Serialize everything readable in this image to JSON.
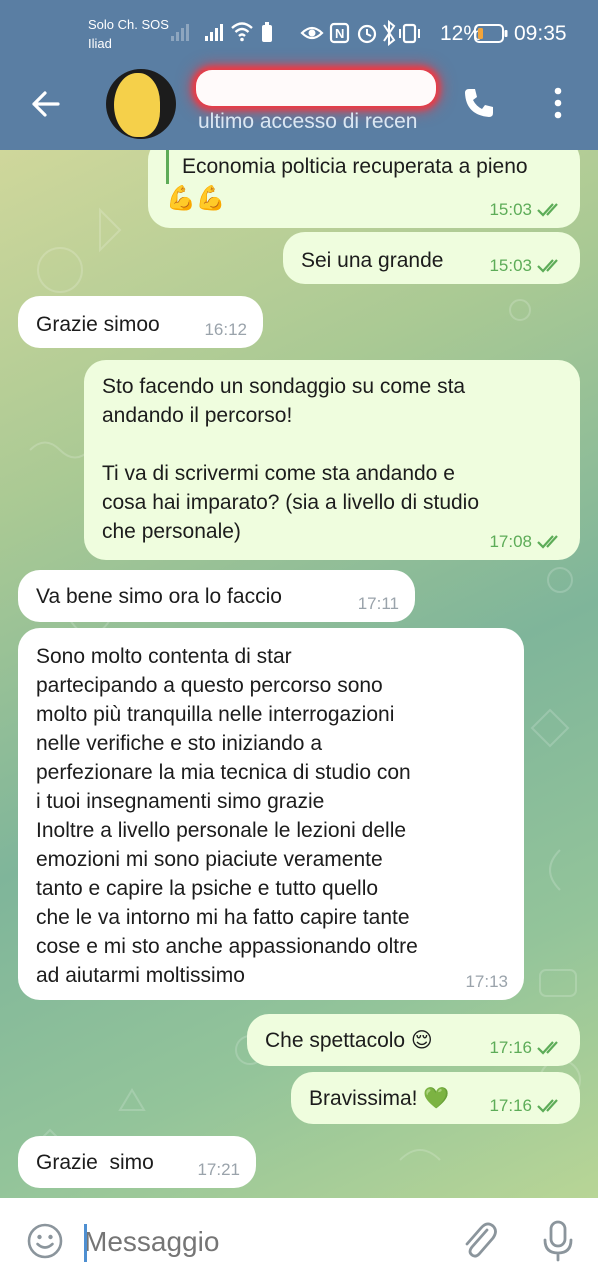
{
  "status_bar": {
    "carrier_1": "Solo Ch. SOS",
    "carrier_2": "Iliad",
    "battery_percent": "12%",
    "time": "09:35"
  },
  "header": {
    "contact_name": "",
    "last_seen": "ultimo accesso di recen"
  },
  "messages": [
    {
      "dir": "out",
      "reply_text": "Economia polticia  recuperata a pieno",
      "emoji": "💪💪",
      "time": "15:03",
      "read": true
    },
    {
      "dir": "out",
      "text": "Sei una grande",
      "time": "15:03",
      "read": true
    },
    {
      "dir": "in",
      "text": "Grazie simoo",
      "time": "16:12"
    },
    {
      "dir": "out",
      "text": "Sto facendo un sondaggio su come sta\nandando il percorso!\n\nTi va di scrivermi come sta andando e\ncosa hai imparato? (sia a livello di studio\nche personale)",
      "time": "17:08",
      "read": true
    },
    {
      "dir": "in",
      "text": "Va bene simo ora lo faccio",
      "time": "17:11"
    },
    {
      "dir": "in",
      "text": "Sono molto contenta di star\npartecipando a questo percorso sono\nmolto più tranquilla nelle interrogazioni\nnelle verifiche e sto iniziando a\nperfezionare la mia tecnica di studio con\ni tuoi insegnamenti simo grazie\nInoltre a livello personale le lezioni delle\nemozioni mi sono piaciute veramente\ntanto e capire la psiche e tutto quello\nche le va intorno mi ha fatto capire tante\ncose e mi sto anche appassionando oltre\nad aiutarmi moltissimo",
      "time": "17:13"
    },
    {
      "dir": "out",
      "text": "Che spettacolo 😌",
      "time": "17:16",
      "read": true
    },
    {
      "dir": "out",
      "text": "Bravissima! 💚",
      "time": "17:16",
      "read": true
    },
    {
      "dir": "in",
      "text": "Grazie  simo",
      "time": "17:21"
    }
  ],
  "input": {
    "placeholder": "Messaggio"
  },
  "colors": {
    "header_bg": "#5a7ea3",
    "outgoing_bubble": "#effdde",
    "incoming_bubble": "#ffffff",
    "read_ticks": "#5dac58",
    "accent": "#4e8fd1"
  },
  "icons": [
    "back-arrow-icon",
    "phone-icon",
    "more-vertical-icon",
    "emoji-icon",
    "attach-icon",
    "microphone-icon",
    "double-check-icon"
  ]
}
